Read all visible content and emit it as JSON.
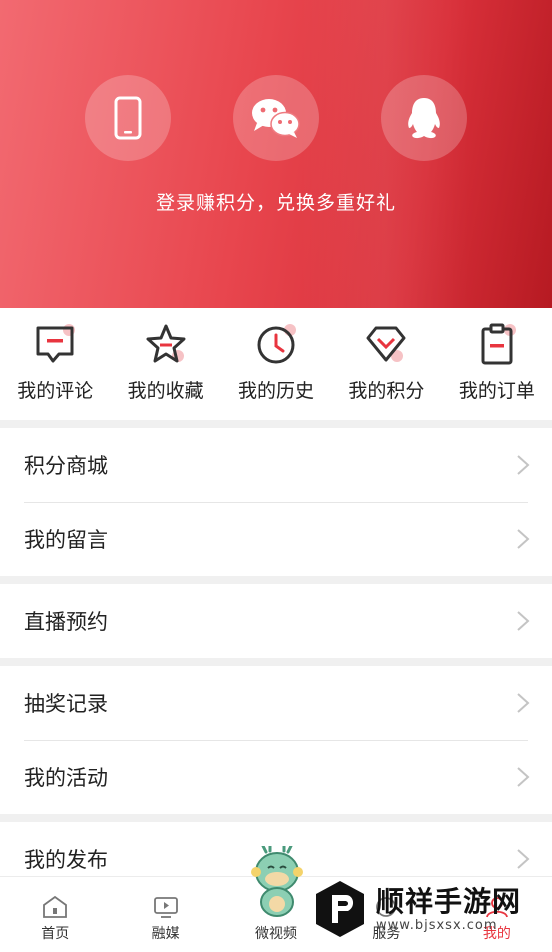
{
  "header": {
    "login_tip": "登录赚积分，兑换多重好礼",
    "login_options": [
      {
        "name": "phone",
        "icon": "phone-icon"
      },
      {
        "name": "wechat",
        "icon": "wechat-icon"
      },
      {
        "name": "qq",
        "icon": "qq-icon"
      }
    ]
  },
  "quick_actions": [
    {
      "label": "我的评论",
      "icon": "comment-icon"
    },
    {
      "label": "我的收藏",
      "icon": "star-icon"
    },
    {
      "label": "我的历史",
      "icon": "clock-icon"
    },
    {
      "label": "我的积分",
      "icon": "diamond-icon"
    },
    {
      "label": "我的订单",
      "icon": "clipboard-icon"
    }
  ],
  "menu": {
    "group1": [
      "积分商城",
      "我的留言"
    ],
    "group2": [
      "直播预约"
    ],
    "group3": [
      "抽奖记录",
      "我的活动"
    ],
    "group4": [
      "我的发布"
    ]
  },
  "tabbar": {
    "tabs": [
      "首页",
      "融媒",
      "微视频",
      "服务",
      "我的"
    ],
    "active_index": 4
  },
  "watermark": {
    "title": "顺祥手游网",
    "url": "www.bjsxsx.com"
  },
  "colors": {
    "accent": "#e8353f",
    "header_start": "#f26a71",
    "header_end": "#b61a22"
  }
}
